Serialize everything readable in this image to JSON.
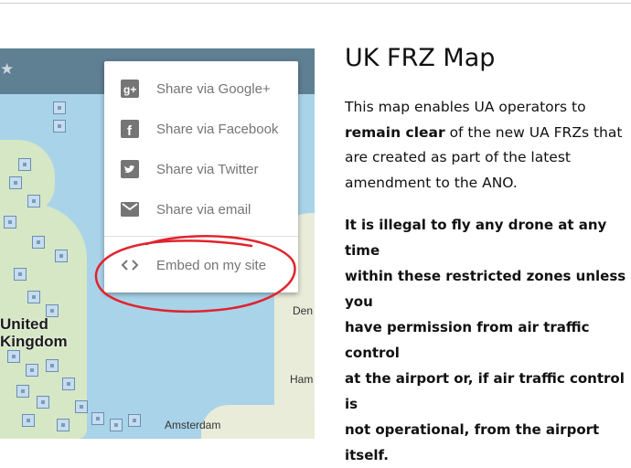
{
  "article": {
    "title": "UK FRZ Map",
    "p1_a": "This map enables UA operators to",
    "p1_bold": "remain clear",
    "p1_b": " of the new UA FRZs that",
    "p1_c": "are created as part of the latest",
    "p1_d": "amendment to the ANO.",
    "p2_lines": [
      "It is illegal to fly any drone at any time",
      "within these restricted zones unless you",
      "have permission from air traffic control",
      "at the airport or, if air traffic control is",
      "not operational, from the airport itself."
    ]
  },
  "map": {
    "labels": {
      "uk_line1": "United",
      "uk_line2": "Kingdom",
      "amsterdam": "Amsterdam",
      "den": "Den",
      "ham": "Ham"
    }
  },
  "share_menu": {
    "items": [
      {
        "label": "Share via Google+",
        "icon": "google-plus-icon"
      },
      {
        "label": "Share via Facebook",
        "icon": "facebook-icon"
      },
      {
        "label": "Share via Twitter",
        "icon": "twitter-icon"
      },
      {
        "label": "Share via email",
        "icon": "email-icon"
      },
      {
        "label": "Embed on my site",
        "icon": "code-icon"
      }
    ]
  },
  "colors": {
    "annotation_ring": "#e0242e",
    "map_header": "#5f7f92",
    "menu_text": "#757575"
  }
}
